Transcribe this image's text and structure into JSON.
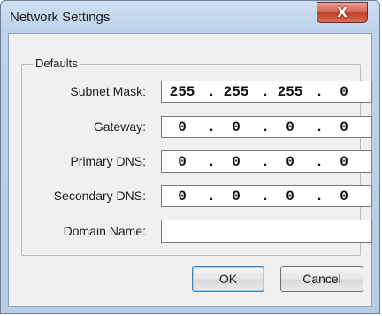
{
  "window": {
    "title": "Network Settings",
    "close_glyph": "X"
  },
  "defaults_group": {
    "legend": "Defaults",
    "subnet_mask": {
      "label": "Subnet Mask:",
      "octets": [
        "255",
        "255",
        "255",
        "0"
      ]
    },
    "gateway": {
      "label": "Gateway:",
      "octets": [
        "0",
        "0",
        "0",
        "0"
      ]
    },
    "primary_dns": {
      "label": "Primary DNS:",
      "octets": [
        "0",
        "0",
        "0",
        "0"
      ]
    },
    "secondary_dns": {
      "label": "Secondary DNS:",
      "octets": [
        "0",
        "0",
        "0",
        "0"
      ]
    },
    "domain_name": {
      "label": "Domain Name:",
      "value": ""
    }
  },
  "buttons": {
    "ok": "OK",
    "cancel": "Cancel"
  },
  "separator": "."
}
